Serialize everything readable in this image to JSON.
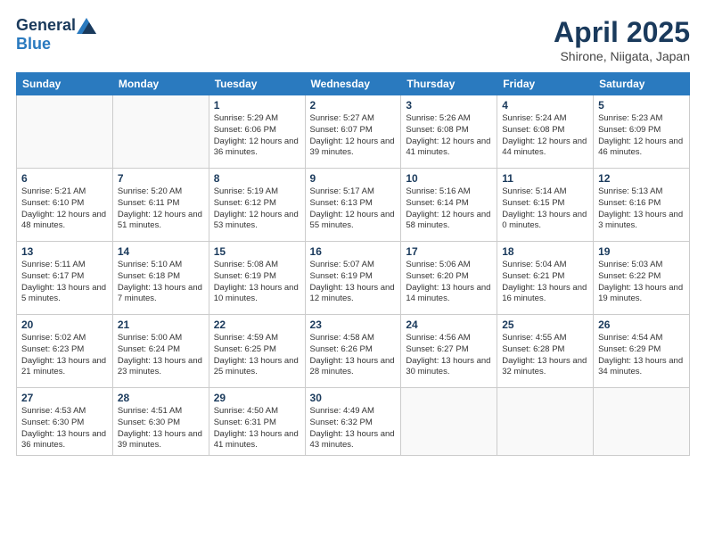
{
  "header": {
    "logo_general": "General",
    "logo_blue": "Blue",
    "title": "April 2025",
    "location": "Shirone, Niigata, Japan"
  },
  "weekdays": [
    "Sunday",
    "Monday",
    "Tuesday",
    "Wednesday",
    "Thursday",
    "Friday",
    "Saturday"
  ],
  "weeks": [
    [
      {
        "day": "",
        "text": ""
      },
      {
        "day": "",
        "text": ""
      },
      {
        "day": "1",
        "text": "Sunrise: 5:29 AM\nSunset: 6:06 PM\nDaylight: 12 hours and 36 minutes."
      },
      {
        "day": "2",
        "text": "Sunrise: 5:27 AM\nSunset: 6:07 PM\nDaylight: 12 hours and 39 minutes."
      },
      {
        "day": "3",
        "text": "Sunrise: 5:26 AM\nSunset: 6:08 PM\nDaylight: 12 hours and 41 minutes."
      },
      {
        "day": "4",
        "text": "Sunrise: 5:24 AM\nSunset: 6:08 PM\nDaylight: 12 hours and 44 minutes."
      },
      {
        "day": "5",
        "text": "Sunrise: 5:23 AM\nSunset: 6:09 PM\nDaylight: 12 hours and 46 minutes."
      }
    ],
    [
      {
        "day": "6",
        "text": "Sunrise: 5:21 AM\nSunset: 6:10 PM\nDaylight: 12 hours and 48 minutes."
      },
      {
        "day": "7",
        "text": "Sunrise: 5:20 AM\nSunset: 6:11 PM\nDaylight: 12 hours and 51 minutes."
      },
      {
        "day": "8",
        "text": "Sunrise: 5:19 AM\nSunset: 6:12 PM\nDaylight: 12 hours and 53 minutes."
      },
      {
        "day": "9",
        "text": "Sunrise: 5:17 AM\nSunset: 6:13 PM\nDaylight: 12 hours and 55 minutes."
      },
      {
        "day": "10",
        "text": "Sunrise: 5:16 AM\nSunset: 6:14 PM\nDaylight: 12 hours and 58 minutes."
      },
      {
        "day": "11",
        "text": "Sunrise: 5:14 AM\nSunset: 6:15 PM\nDaylight: 13 hours and 0 minutes."
      },
      {
        "day": "12",
        "text": "Sunrise: 5:13 AM\nSunset: 6:16 PM\nDaylight: 13 hours and 3 minutes."
      }
    ],
    [
      {
        "day": "13",
        "text": "Sunrise: 5:11 AM\nSunset: 6:17 PM\nDaylight: 13 hours and 5 minutes."
      },
      {
        "day": "14",
        "text": "Sunrise: 5:10 AM\nSunset: 6:18 PM\nDaylight: 13 hours and 7 minutes."
      },
      {
        "day": "15",
        "text": "Sunrise: 5:08 AM\nSunset: 6:19 PM\nDaylight: 13 hours and 10 minutes."
      },
      {
        "day": "16",
        "text": "Sunrise: 5:07 AM\nSunset: 6:19 PM\nDaylight: 13 hours and 12 minutes."
      },
      {
        "day": "17",
        "text": "Sunrise: 5:06 AM\nSunset: 6:20 PM\nDaylight: 13 hours and 14 minutes."
      },
      {
        "day": "18",
        "text": "Sunrise: 5:04 AM\nSunset: 6:21 PM\nDaylight: 13 hours and 16 minutes."
      },
      {
        "day": "19",
        "text": "Sunrise: 5:03 AM\nSunset: 6:22 PM\nDaylight: 13 hours and 19 minutes."
      }
    ],
    [
      {
        "day": "20",
        "text": "Sunrise: 5:02 AM\nSunset: 6:23 PM\nDaylight: 13 hours and 21 minutes."
      },
      {
        "day": "21",
        "text": "Sunrise: 5:00 AM\nSunset: 6:24 PM\nDaylight: 13 hours and 23 minutes."
      },
      {
        "day": "22",
        "text": "Sunrise: 4:59 AM\nSunset: 6:25 PM\nDaylight: 13 hours and 25 minutes."
      },
      {
        "day": "23",
        "text": "Sunrise: 4:58 AM\nSunset: 6:26 PM\nDaylight: 13 hours and 28 minutes."
      },
      {
        "day": "24",
        "text": "Sunrise: 4:56 AM\nSunset: 6:27 PM\nDaylight: 13 hours and 30 minutes."
      },
      {
        "day": "25",
        "text": "Sunrise: 4:55 AM\nSunset: 6:28 PM\nDaylight: 13 hours and 32 minutes."
      },
      {
        "day": "26",
        "text": "Sunrise: 4:54 AM\nSunset: 6:29 PM\nDaylight: 13 hours and 34 minutes."
      }
    ],
    [
      {
        "day": "27",
        "text": "Sunrise: 4:53 AM\nSunset: 6:30 PM\nDaylight: 13 hours and 36 minutes."
      },
      {
        "day": "28",
        "text": "Sunrise: 4:51 AM\nSunset: 6:30 PM\nDaylight: 13 hours and 39 minutes."
      },
      {
        "day": "29",
        "text": "Sunrise: 4:50 AM\nSunset: 6:31 PM\nDaylight: 13 hours and 41 minutes."
      },
      {
        "day": "30",
        "text": "Sunrise: 4:49 AM\nSunset: 6:32 PM\nDaylight: 13 hours and 43 minutes."
      },
      {
        "day": "",
        "text": ""
      },
      {
        "day": "",
        "text": ""
      },
      {
        "day": "",
        "text": ""
      }
    ]
  ]
}
